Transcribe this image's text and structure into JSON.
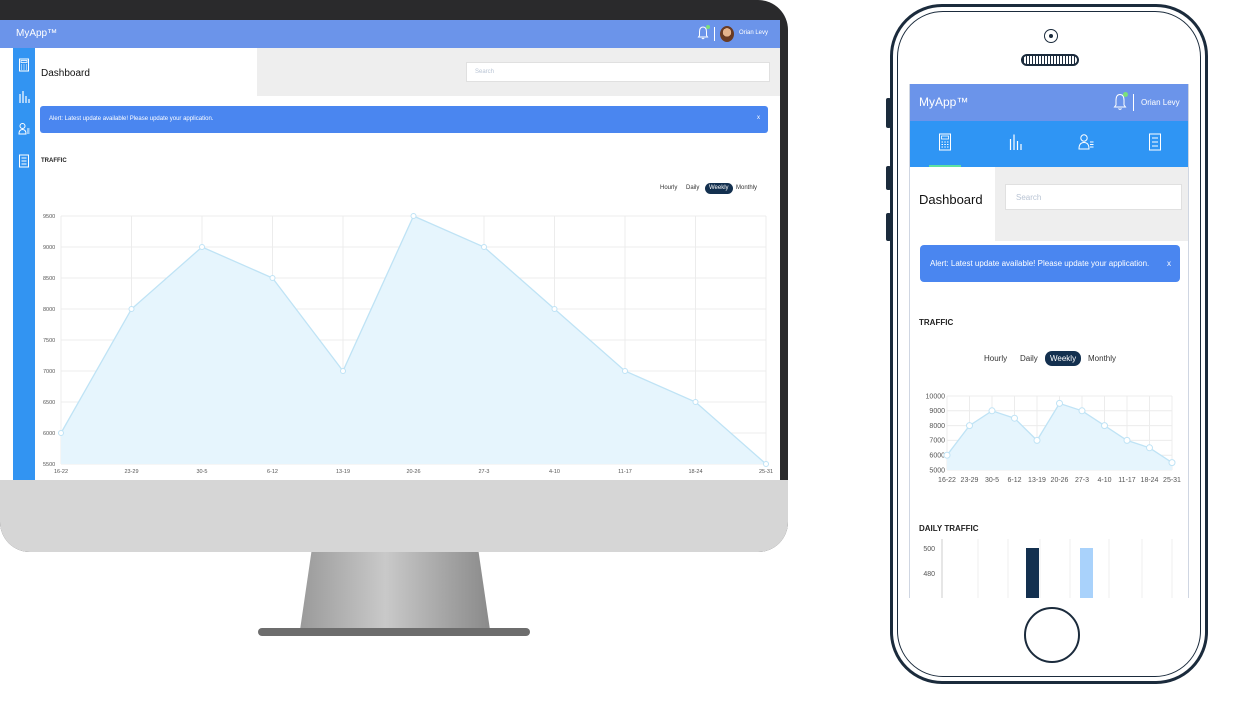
{
  "desktop": {
    "brand": "MyApp™",
    "user_name": "Orian Levy",
    "page_title": "Dashboard",
    "search_placeholder": "Search",
    "alert_text": "Alert: Latest update available! Please update your application.",
    "alert_close": "x",
    "section_title": "TRAFFIC",
    "tabs": [
      "Hourly",
      "Daily",
      "Weekly",
      "Monthly"
    ],
    "active_tab": "Weekly"
  },
  "mobile": {
    "brand": "MyApp™",
    "user_name": "Orian Levy",
    "nav_icons": [
      "calculator-icon",
      "bar-chart-icon",
      "user-list-icon",
      "report-icon"
    ],
    "page_title": "Dashboard",
    "search_placeholder": "Search",
    "alert_text": "Alert: Latest update available! Please update your application.",
    "alert_close": "x",
    "section_title": "TRAFFIC",
    "tabs": [
      "Hourly",
      "Daily",
      "Weekly",
      "Monthly"
    ],
    "active_tab": "Weekly",
    "daily_section_title": "DAILY TRAFFIC"
  },
  "colors": {
    "topbar": "#6b94ea",
    "sidebar": "#3294f2",
    "alert": "#4a86f0",
    "active_tab": "#13304f",
    "area_fill": "#e6f5fd",
    "line": "#bfe3f5"
  },
  "chart_data": [
    {
      "type": "area",
      "categories": [
        "16-22",
        "23-29",
        "30-5",
        "6-12",
        "13-19",
        "20-26",
        "27-3",
        "4-10",
        "11-17",
        "18-24",
        "25-31"
      ],
      "values": [
        6000,
        8000,
        9000,
        8500,
        7000,
        9500,
        9000,
        8000,
        7000,
        6500,
        5500
      ],
      "yticks": [
        "9500",
        "9000",
        "8500",
        "8000",
        "7500",
        "7000",
        "6500",
        "6000",
        "5500"
      ],
      "ylim": [
        5500,
        9500
      ],
      "grid": true
    },
    {
      "type": "area",
      "categories": [
        "16-22",
        "23-29",
        "30-5",
        "6-12",
        "13-19",
        "20-26",
        "27-3",
        "4-10",
        "11-17",
        "18-24",
        "25-31"
      ],
      "values": [
        6000,
        8000,
        9000,
        8500,
        7000,
        9500,
        9000,
        8000,
        7000,
        6500,
        5500
      ],
      "yticks": [
        "10000",
        "9000",
        "8000",
        "7000",
        "6000",
        "5000"
      ],
      "ylim": [
        5000,
        10000
      ],
      "grid": true
    },
    {
      "type": "bar",
      "yticks": [
        "500",
        "480"
      ],
      "ylim": [
        460,
        500
      ],
      "values": [
        500,
        500
      ],
      "colors": [
        "#13304f",
        "#a9d2fb"
      ]
    }
  ]
}
